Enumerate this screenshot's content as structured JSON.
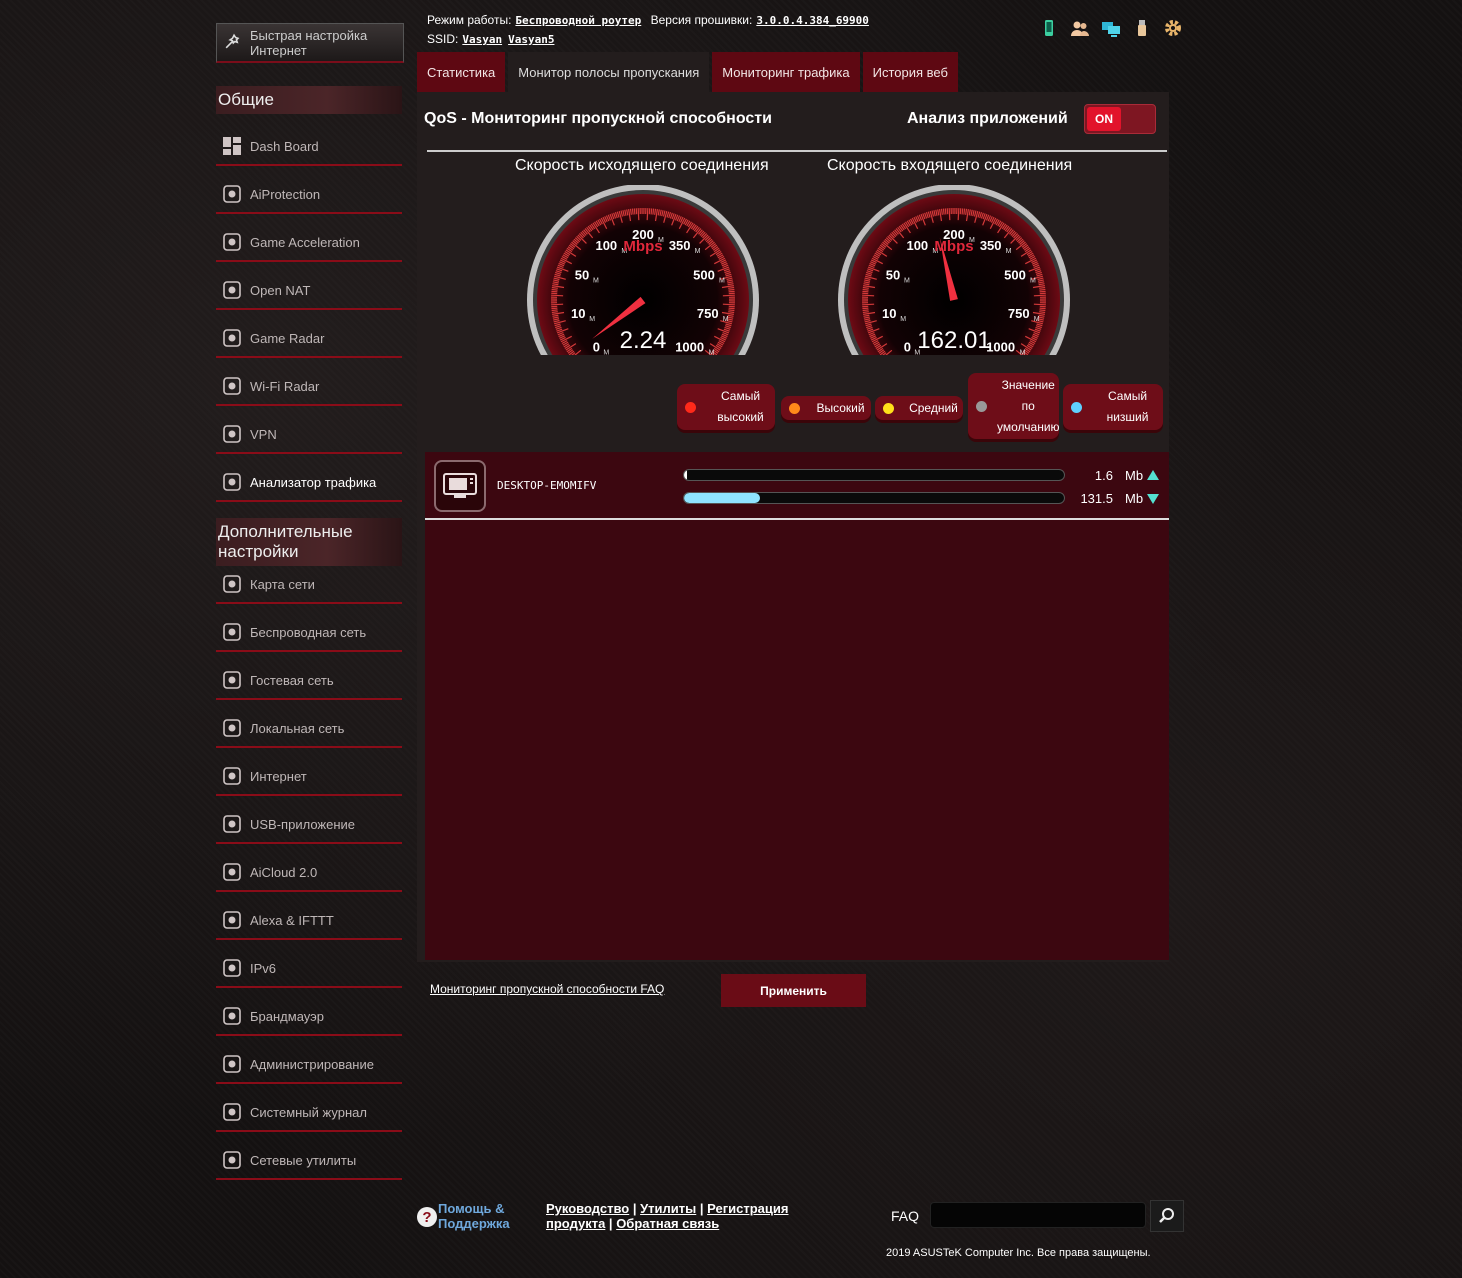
{
  "sidebar": {
    "quick_setup": "Быстрая настройка Интернет",
    "general_title": "Общие",
    "general_items": [
      {
        "label": "Dash Board",
        "icon": "dashboard-icon"
      },
      {
        "label": "AiProtection",
        "icon": "shield-lock-icon"
      },
      {
        "label": "Game Acceleration",
        "icon": "rocket-icon"
      },
      {
        "label": "Open NAT",
        "icon": "nat-icon"
      },
      {
        "label": "Game Radar",
        "icon": "radar-icon"
      },
      {
        "label": "Wi-Fi Radar",
        "icon": "wifi-radar-icon"
      },
      {
        "label": "VPN",
        "icon": "vpn-icon"
      },
      {
        "label": "Анализатор трафика",
        "icon": "traffic-analyzer-icon"
      }
    ],
    "advanced_title": "Дополнительные настройки",
    "advanced_items": [
      {
        "label": "Карта сети",
        "icon": "network-map-icon"
      },
      {
        "label": "Беспроводная сеть",
        "icon": "wireless-icon"
      },
      {
        "label": "Гостевая сеть",
        "icon": "guest-network-icon"
      },
      {
        "label": "Локальная сеть",
        "icon": "lan-icon"
      },
      {
        "label": "Интернет",
        "icon": "globe-icon"
      },
      {
        "label": "USB-приложение",
        "icon": "usb-icon"
      },
      {
        "label": "AiCloud 2.0",
        "icon": "cloud-icon"
      },
      {
        "label": "Alexa & IFTTT",
        "icon": "alexa-icon"
      },
      {
        "label": "IPv6",
        "icon": "ipv6-icon"
      },
      {
        "label": "Брандмауэр",
        "icon": "firewall-icon"
      },
      {
        "label": "Администрирование",
        "icon": "admin-gear-icon"
      },
      {
        "label": "Системный журнал",
        "icon": "syslog-icon"
      },
      {
        "label": "Сетевые утилиты",
        "icon": "tools-gear-icon"
      }
    ]
  },
  "header": {
    "mode_label": "Режим работы:",
    "mode_value": "Беспроводной роутер",
    "fw_label": "Версия прошивки:",
    "fw_value": "3.0.0.4.384_69900",
    "ssid_label": "SSID:",
    "ssid_1": "Vasyan",
    "ssid_2": "Vasyan5",
    "icons": [
      "mobile-app-icon",
      "clients-icon",
      "network-monitor-icon",
      "usb-device-icon",
      "settings-gear-icon"
    ]
  },
  "tabs": [
    "Статистика",
    "Монитор полосы пропускания",
    "Мониторинг трафика",
    "История веб"
  ],
  "active_tab": 1,
  "qos": {
    "title": "QoS - Мониторинг пропускной способности",
    "app_analysis_label": "Анализ приложений",
    "toggle_label": "ON",
    "toggle_state": true
  },
  "gauges": {
    "upload": {
      "title": "Скорость исходящего соединения",
      "value": "2.24",
      "value_num": 2.24
    },
    "download": {
      "title": "Скорость входящего соединения",
      "value": "162.01",
      "value_num": 162.01
    },
    "unit": "Mbps",
    "ticks": [
      {
        "value": "0",
        "unit": "M"
      },
      {
        "value": "10",
        "unit": "M"
      },
      {
        "value": "50",
        "unit": "M"
      },
      {
        "value": "100",
        "unit": "M"
      },
      {
        "value": "200",
        "unit": "M"
      },
      {
        "value": "350",
        "unit": "M"
      },
      {
        "value": "500",
        "unit": "M"
      },
      {
        "value": "750",
        "unit": "M"
      },
      {
        "value": "1000",
        "unit": "M"
      }
    ]
  },
  "priorities": [
    {
      "label": "Самый высокий",
      "color": "#ff2a1a"
    },
    {
      "label": "Высокий",
      "color": "#ff8a1a"
    },
    {
      "label": "Средний",
      "color": "#ffe01a"
    },
    {
      "label": "Значение по умолчанию",
      "color": "#999999"
    },
    {
      "label": "Самый низший",
      "color": "#5fd0ff"
    }
  ],
  "devices": [
    {
      "name": "DESKTOP-EMOMIFV",
      "upload": "1.6",
      "download": "131.5",
      "unit_up": "Mb",
      "unit_down": "Mb",
      "upload_fraction": 0.005,
      "download_fraction": 0.2
    }
  ],
  "faq_link": "Мониторинг пропускной способности FAQ",
  "apply_label": "Применить",
  "footer": {
    "help": "Помощь & Поддержка",
    "links": [
      "Руководство",
      "Утилиты",
      "Регистрация продукта",
      "Обратная связь"
    ],
    "faq_label": "FAQ",
    "faq_placeholder": "",
    "copyright": "2019 ASUSTeK Computer Inc. Все права защищены."
  },
  "colors": {
    "accent": "#8a0c18",
    "brand_red": "#e2132b",
    "panel": "#231d1d",
    "list_bg": "#3c0710"
  }
}
